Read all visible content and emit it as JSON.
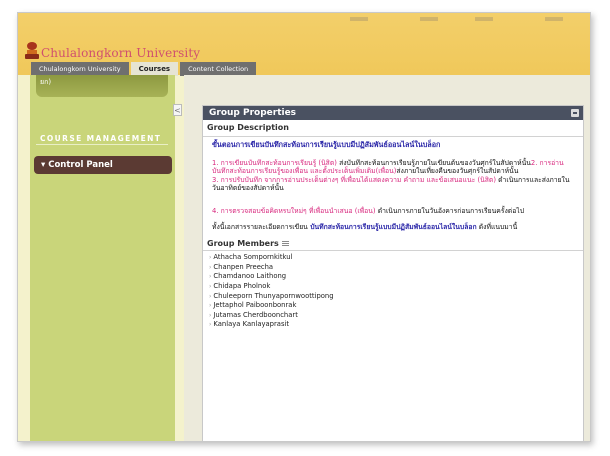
{
  "brand": {
    "name": "Chulalongkorn University",
    "accent": "#f0c85a",
    "text_color": "#d0506e"
  },
  "tabs": [
    {
      "label": "Chulalongkorn University"
    },
    {
      "label": "Courses"
    },
    {
      "label": "Content Collection"
    }
  ],
  "sidebar": {
    "top_item": "ยก)",
    "heading": "COURSE MANAGEMENT",
    "control_panel": "Control Panel",
    "collapse_glyph": "<"
  },
  "panel": {
    "title": "Group Properties",
    "description_head": "Group Description",
    "p1": "ขั้นตอนการเขียนบันทึกสะท้อนการเรียนรู้แบบมีปฏิสัมพันธ์ออนไลน์ในบล็อก",
    "p2a": "1. การเขียนบันทึกสะท้อนการเรียนรู้ (นิสิต)",
    "p2b": " ส่งบันทึกสะท้อนการเรียนรู้ภายในเขียนต้นของวันศุกร์ในสัปดาห์นั้น",
    "p2c": "2. การอ่านบันทึกสะท้อนการเรียนรู้ของเพื่อน และตั้งประเด็นเพิ่มเติม(เพื่อน)",
    "p2d": "ส่งภายในเที่ยงคืนของวันศุกร์ในสัปดาห์นั้น",
    "p2e": "3. การปรับบันทึก จากการอ่านประเด็นต่างๆ ที่เพื่อนได้แสดงความ คำถาม และข้อเสนอแนะ",
    "p2f": " (นิสิต)",
    "p2g": " ดำเนินการและส่งภายในวันอาทิตย์ของสัปดาห์นั้น",
    "p3a": "4. การตรวจสอบข้อคิดหรบใหม่ๆ ที่เพื่อนนำเสนอ",
    "p3b": " (เพื่อน)",
    "p3c": " ดำเนินการภายในวันอังคารก่อนการเรียนครั้งต่อไป",
    "p4a": "ทั้งนี้เอกสารรายละเอียดการเขียน",
    "p4b": " บันทึกสะท้อนการเรียนรู้แบบมีปฏิสัมพันธ์ออนไลน์ในบล็อก",
    "p4c": " ดังที่แนบมานี้",
    "members_head": "Group Members",
    "members": [
      "Athacha Sompornkitkul",
      "Chanpen Preecha",
      "Chamdanoo Laithong",
      "Chidapa Pholnok",
      "Chuleeporn Thunyapornwoottipong",
      "Jettaphol Paiboonbonrak",
      "Jutamas Cherdboonchart",
      "Kanlaya Kanlayaprasit"
    ]
  }
}
